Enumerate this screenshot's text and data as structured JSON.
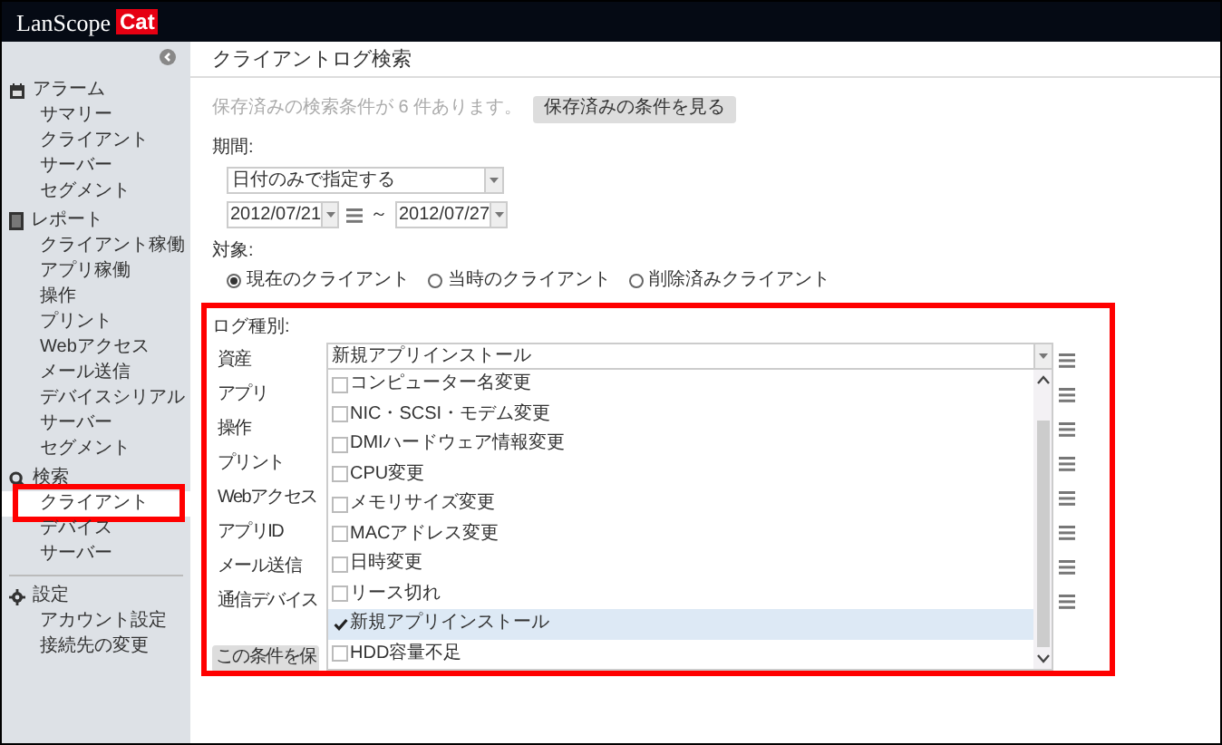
{
  "header": {
    "logo_text": "LanScope",
    "logo_badge": "Cat"
  },
  "sidebar": {
    "sections": [
      {
        "kind": "alarm",
        "label": "アラーム",
        "items": [
          {
            "label": "サマリー",
            "selected": false
          },
          {
            "label": "クライアント",
            "selected": false
          },
          {
            "label": "サーバー",
            "selected": false
          },
          {
            "label": "セグメント",
            "selected": false
          }
        ]
      },
      {
        "kind": "report",
        "label": "レポート",
        "items": [
          {
            "label": "クライアント稼働",
            "selected": false
          },
          {
            "label": "アプリ稼働",
            "selected": false
          },
          {
            "label": "操作",
            "selected": false
          },
          {
            "label": "プリント",
            "selected": false
          },
          {
            "label": "Webアクセス",
            "selected": false
          },
          {
            "label": "メール送信",
            "selected": false
          },
          {
            "label": "デバイスシリアル",
            "selected": false
          },
          {
            "label": "サーバー",
            "selected": false
          },
          {
            "label": "セグメント",
            "selected": false
          }
        ]
      },
      {
        "kind": "search",
        "label": "検索",
        "items": [
          {
            "label": "クライアント",
            "selected": true
          },
          {
            "label": "デバイス",
            "selected": false
          },
          {
            "label": "サーバー",
            "selected": false
          }
        ]
      },
      {
        "kind": "settings",
        "label": "設定",
        "items": [
          {
            "label": "アカウント設定",
            "selected": false
          },
          {
            "label": "接続先の変更",
            "selected": false
          }
        ]
      }
    ]
  },
  "main": {
    "title": "クライアントログ検索",
    "saved_note": "保存済みの検索条件が 6 件あります。",
    "saved_button": "保存済みの条件を見る",
    "period_label": "期間:",
    "period_select": "日付のみで指定する",
    "date_from": "2012/07/21",
    "date_separator": "～",
    "date_to": "2012/07/27",
    "target_label": "対象:",
    "targets": [
      {
        "label": "現在のクライアント",
        "selected": true
      },
      {
        "label": "当時のクライアント",
        "selected": false
      },
      {
        "label": "削除済みクライアント",
        "selected": false
      }
    ],
    "log_type_label": "ログ種別:",
    "log_rows": [
      "資産",
      "アプリ",
      "操作",
      "プリント",
      "Webアクセス",
      "アプリID",
      "メール送信",
      "通信デバイス"
    ],
    "asset_select": "新規アプリインストール",
    "asset_options": [
      {
        "label": "コンピューター名変更",
        "checked": false,
        "selected": false
      },
      {
        "label": "NIC・SCSI・モデム変更",
        "checked": false,
        "selected": false
      },
      {
        "label": "DMIハードウェア情報変更",
        "checked": false,
        "selected": false
      },
      {
        "label": "CPU変更",
        "checked": false,
        "selected": false
      },
      {
        "label": "メモリサイズ変更",
        "checked": false,
        "selected": false
      },
      {
        "label": "MACアドレス変更",
        "checked": false,
        "selected": false
      },
      {
        "label": "日時変更",
        "checked": false,
        "selected": false
      },
      {
        "label": "リース切れ",
        "checked": false,
        "selected": false
      },
      {
        "label": "新規アプリインストール",
        "checked": true,
        "selected": true
      },
      {
        "label": "HDD容量不足",
        "checked": false,
        "selected": false
      }
    ],
    "save_button": "この条件を保"
  }
}
